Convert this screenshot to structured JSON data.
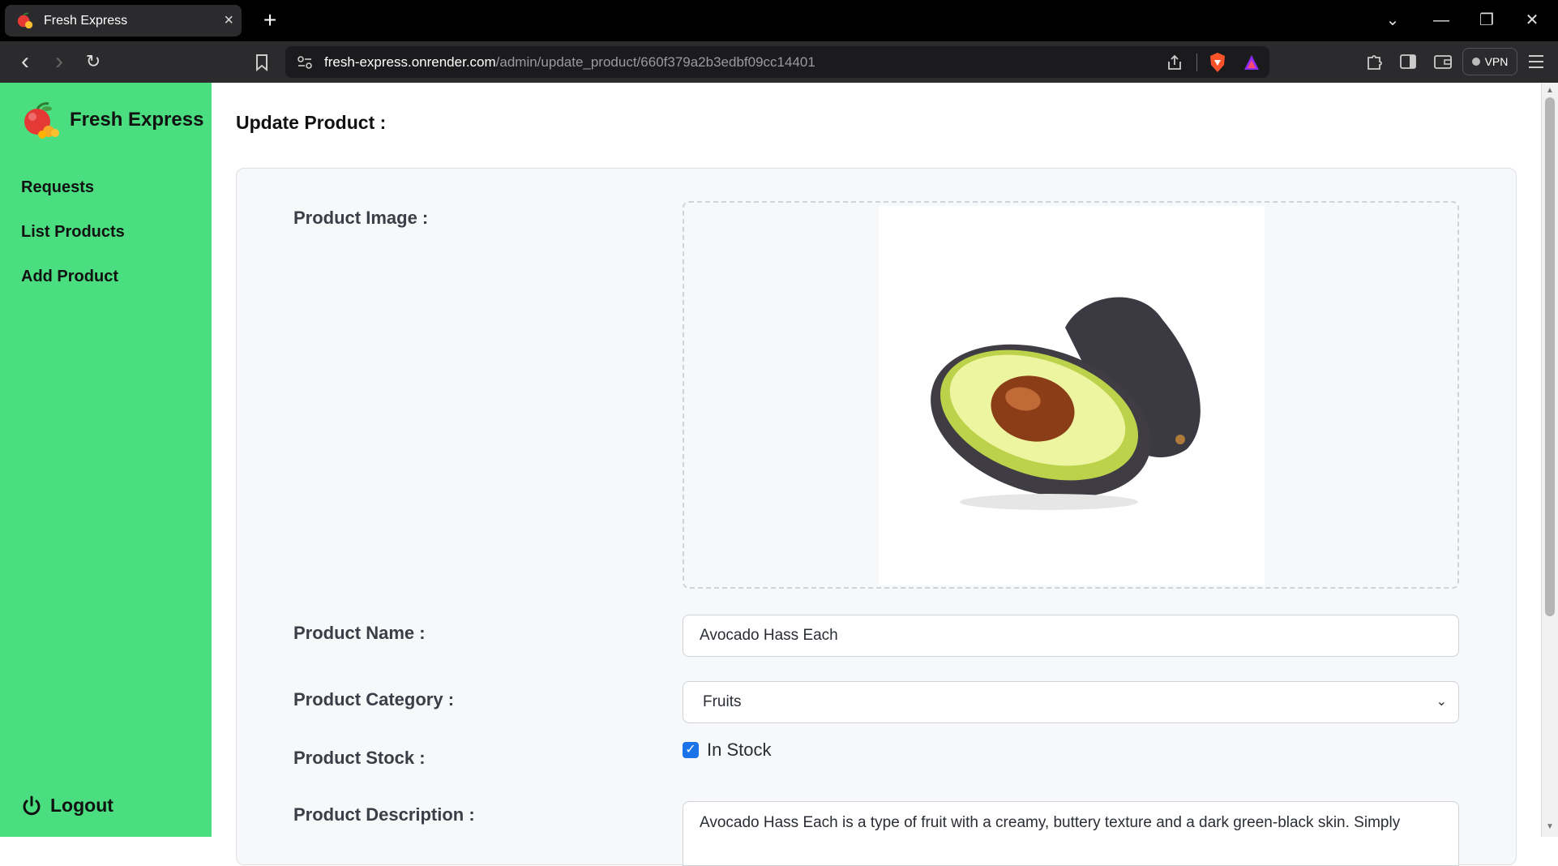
{
  "browser": {
    "tab_title": "Fresh Express",
    "tab_close": "×",
    "new_tab": "+",
    "url_host": "fresh-express.onrender.com",
    "url_path": "/admin/update_product/660f379a2b3edbf09cc14401",
    "vpn_label": "VPN",
    "window_controls": {
      "dropdown": "⌄",
      "minimize": "—",
      "restore": "❐",
      "close": "✕"
    },
    "nav": {
      "back": "‹",
      "forward": "›",
      "reload": "↻"
    }
  },
  "sidebar": {
    "brand": "Fresh Express",
    "items": [
      {
        "label": "Requests"
      },
      {
        "label": "List Products"
      },
      {
        "label": "Add Product"
      }
    ],
    "logout": "Logout"
  },
  "main": {
    "heading": "Update Product :",
    "form": {
      "image_label": "Product Image :",
      "name_label": "Product Name :",
      "name_value": "Avocado Hass Each",
      "category_label": "Product Category :",
      "category_value": "Fruits",
      "stock_label": "Product Stock :",
      "stock_checkbox_label": "In Stock",
      "stock_checked": true,
      "description_label": "Product Description :",
      "description_value": "Avocado Hass Each is a type of fruit with a creamy, buttery texture and a dark green-black skin. Simply"
    }
  },
  "colors": {
    "sidebar_bg": "#4ade80",
    "checkbox": "#1a73e8"
  }
}
